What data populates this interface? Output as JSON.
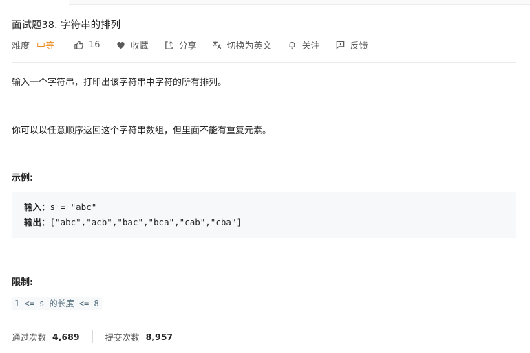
{
  "problem": {
    "title": "面试题38. 字符串的排列",
    "difficulty_label": "难度",
    "difficulty_value": "中等",
    "difficulty_color": "#ef8a1f",
    "likes": "16",
    "favorite_label": "收藏",
    "share_label": "分享",
    "translate_label": "切换为英文",
    "follow_label": "关注",
    "feedback_label": "反馈"
  },
  "description": {
    "para1": "输入一个字符串，打印出该字符串中字符的所有排列。",
    "para2": "你可以以任意顺序返回这个字符串数组，但里面不能有重复元素。",
    "example_title": "示例:",
    "example_input_label": "输入：",
    "example_input_value": "s = \"abc\"",
    "example_output_label": "输出：",
    "example_output_value": "[\"abc\",\"acb\",\"bac\",\"bca\",\"cab\",\"cba\"]",
    "limit_title": "限制:",
    "limit_text": "1 <= s 的长度 <= 8"
  },
  "stats": {
    "accepted_label": "通过次数",
    "accepted_value": "4,689",
    "submitted_label": "提交次数",
    "submitted_value": "8,957"
  },
  "icons": {
    "like": "thumbs-up-icon",
    "favorite": "heart-icon",
    "share": "share-icon",
    "translate": "translate-icon",
    "follow": "bell-icon",
    "feedback": "feedback-icon"
  }
}
